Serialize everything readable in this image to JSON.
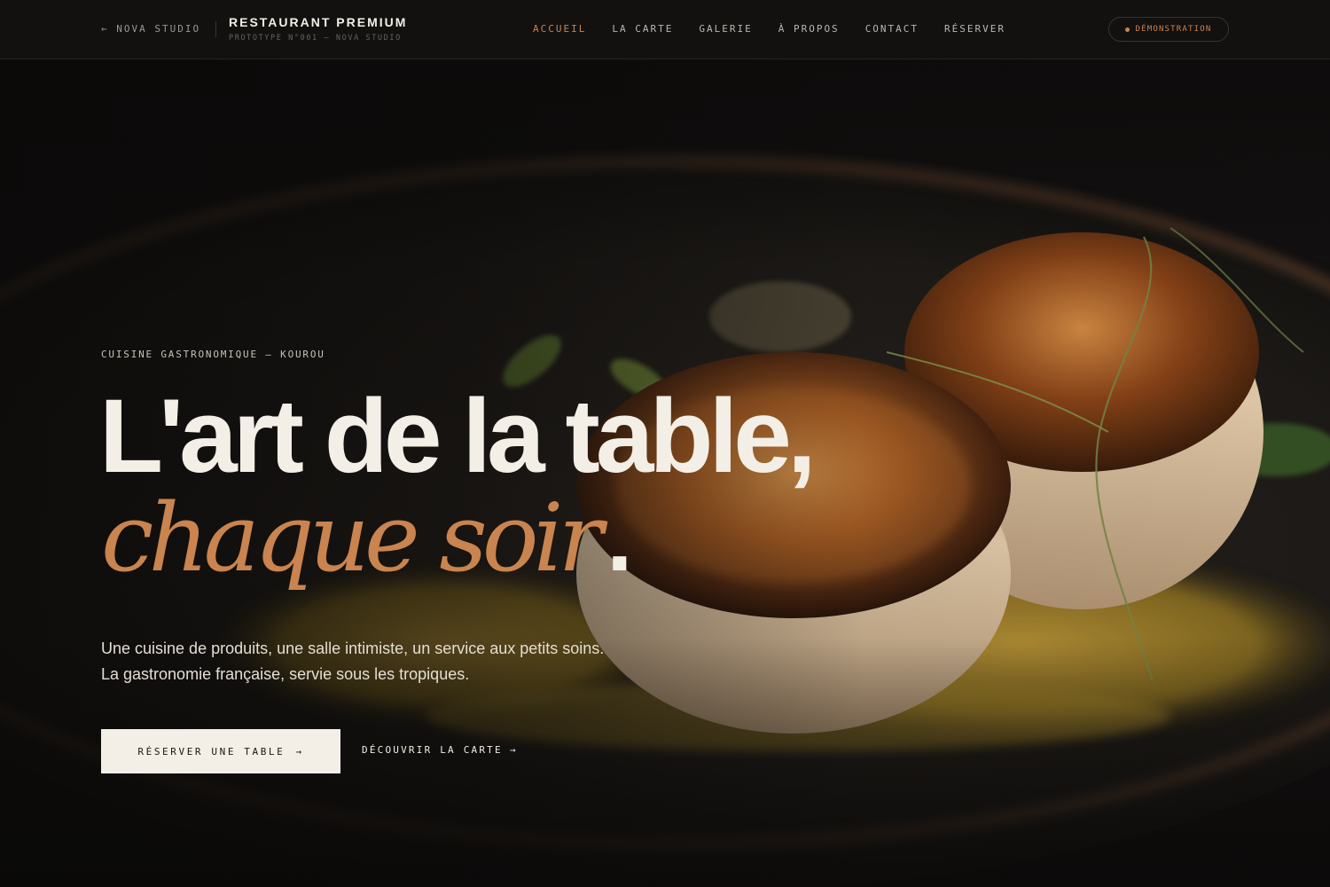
{
  "header": {
    "back_label": "← NOVA STUDIO",
    "brand_title": "RESTAURANT PREMIUM",
    "brand_subtitle": "PROTOTYPE N°001 — NOVA STUDIO",
    "nav": [
      {
        "label": "ACCUEIL",
        "active": true
      },
      {
        "label": "LA CARTE",
        "active": false
      },
      {
        "label": "GALERIE",
        "active": false
      },
      {
        "label": "À PROPOS",
        "active": false
      },
      {
        "label": "CONTACT",
        "active": false
      },
      {
        "label": "RÉSERVER",
        "active": false
      }
    ],
    "demo_badge": "DÉMONSTRATION"
  },
  "hero": {
    "eyebrow": "CUISINE GASTRONOMIQUE — KOUROU",
    "headline_line1": "L'art de la table,",
    "headline_line2_accent": "chaque soir",
    "headline_line2_end": ".",
    "lede_line1": "Une cuisine de produits, une salle intimiste, un service aux petits soins.",
    "lede_line2": "La gastronomie française, servie sous les tropiques.",
    "cta_primary": "RÉSERVER UNE TABLE",
    "cta_primary_arrow": "→",
    "cta_secondary": "DÉCOUVRIR LA CARTE",
    "cta_secondary_arrow": "→",
    "background_image": "seared-scallops-plate"
  },
  "colors": {
    "background": "#0d0c0b",
    "accent": "#c9844f",
    "text": "#f4efe6",
    "button_bg": "#f3efe7"
  }
}
